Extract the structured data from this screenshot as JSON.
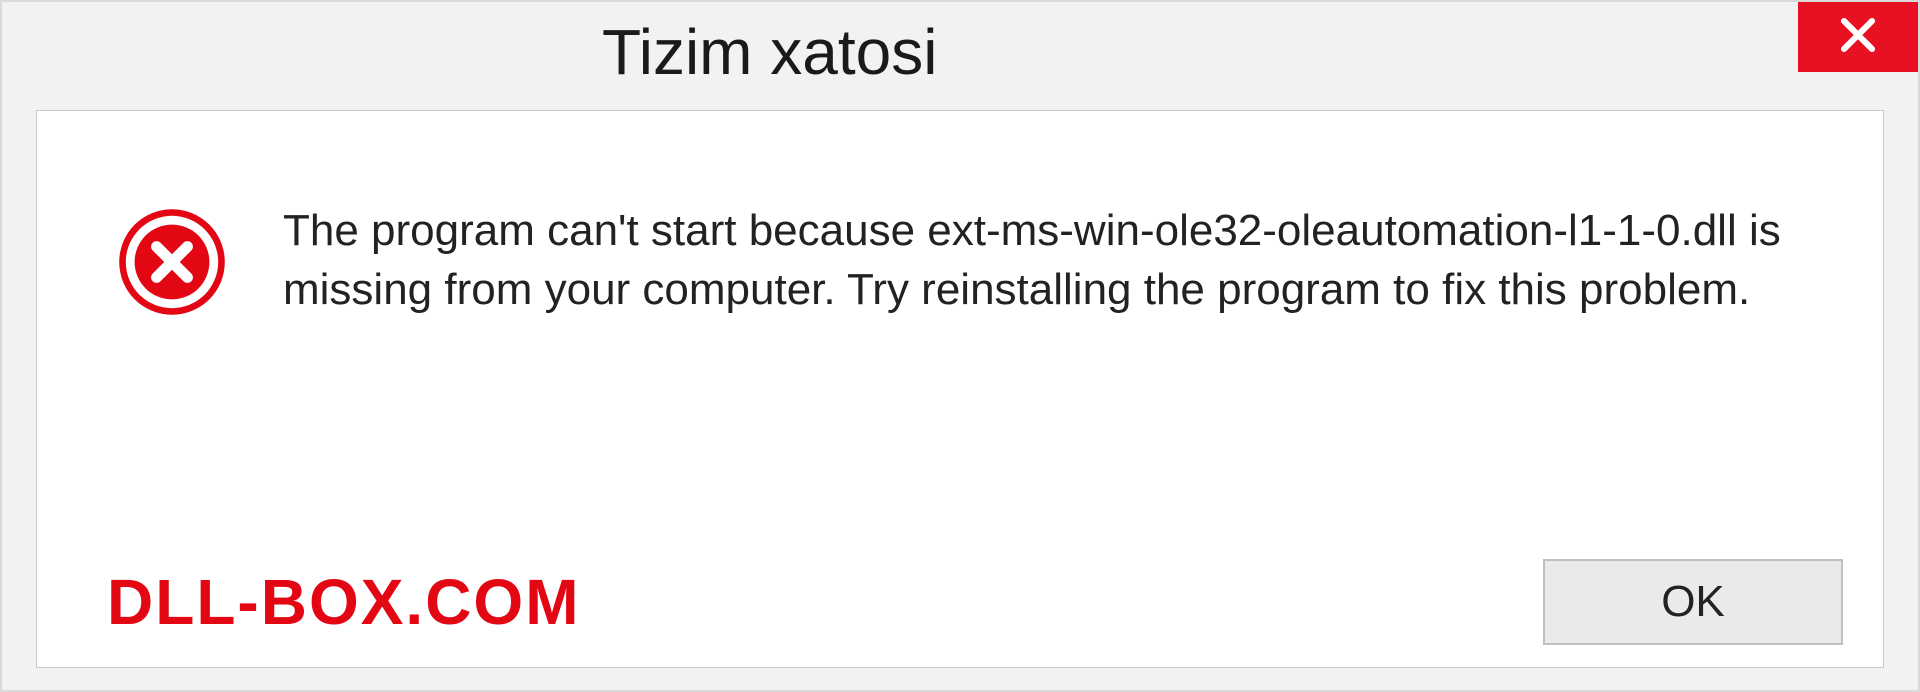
{
  "dialog": {
    "title": "Tizim xatosi",
    "message": "The program can't start because ext-ms-win-ole32-oleautomation-l1-1-0.dll is missing from your computer. Try reinstalling the program to fix this problem.",
    "ok_label": "OK"
  },
  "watermark": "DLL-BOX.COM",
  "colors": {
    "close_bg": "#e81123",
    "error_icon": "#e30613",
    "watermark": "#e30613"
  }
}
